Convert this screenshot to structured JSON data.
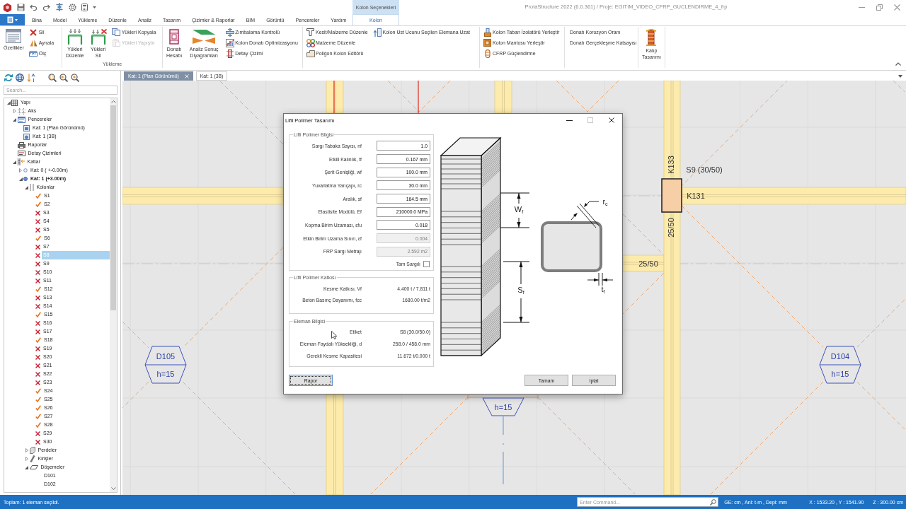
{
  "window": {
    "title": "ProtaStructure 2022 (6.0.361) / Proje: EGITIM_VIDEO_CFRP_GUCLENDIRME_4_frp"
  },
  "ribbon": {
    "context_header": "Kolon Seçenekleri",
    "tabs": [
      {
        "label": "Bina",
        "selected": false
      },
      {
        "label": "Model",
        "selected": false
      },
      {
        "label": "Yükleme",
        "selected": false
      },
      {
        "label": "Düzenle",
        "selected": false
      },
      {
        "label": "Analiz",
        "selected": false
      },
      {
        "label": "Tasarım",
        "selected": false
      },
      {
        "label": "Çizimler & Raporlar",
        "selected": false
      },
      {
        "label": "BIM",
        "selected": false
      },
      {
        "label": "Görüntü",
        "selected": false
      },
      {
        "label": "Pencereler",
        "selected": false
      },
      {
        "label": "Yardım",
        "selected": false
      },
      {
        "label": "Kolon",
        "selected": true
      }
    ],
    "groups": [
      {
        "items": [
          {
            "kind": "large",
            "label": "Özellikler",
            "disabled": false
          },
          {
            "kind": "small",
            "label": "Sil",
            "disabled": false
          },
          {
            "kind": "small",
            "label": "Aynala",
            "disabled": false
          },
          {
            "kind": "small",
            "label": "Ölç",
            "disabled": false
          }
        ]
      },
      {
        "label": "Yükleme",
        "items": [
          {
            "kind": "large",
            "label": "Yükleri Düzenle",
            "disabled": false
          },
          {
            "kind": "large",
            "label": "Yükleri Sil",
            "disabled": false
          },
          {
            "kind": "small",
            "label": "Yükleri Kopyala",
            "disabled": false
          },
          {
            "kind": "small",
            "label": "Yükleri Yapıştır",
            "disabled": true
          }
        ]
      },
      {
        "items": [
          {
            "kind": "large",
            "label": "Donatı Hesabı",
            "disabled": false
          },
          {
            "kind": "large",
            "label": "Analiz Sonuç Diyagramları",
            "disabled": false
          },
          {
            "kind": "small",
            "label": "Zımbalama Kontrolü",
            "disabled": false
          },
          {
            "kind": "small",
            "label": "Kolon Donatı Optimizasyonu",
            "disabled": false
          },
          {
            "kind": "small",
            "label": "Detay Çizimi",
            "disabled": false
          }
        ]
      },
      {
        "items": [
          {
            "kind": "small",
            "label": "Kesit/Malzeme Düzenle",
            "disabled": false
          },
          {
            "kind": "small",
            "label": "Malzeme Düzenle",
            "disabled": false
          },
          {
            "kind": "small",
            "label": "Poligon Kolon Editörü",
            "disabled": false
          },
          {
            "kind": "small",
            "label": "Kolon Üst Ucunu Seçilen Elemana Uzat",
            "disabled": false
          }
        ]
      },
      {
        "items": [
          {
            "kind": "small",
            "label": "Kolon Taban İzolatörü Yerleştir",
            "disabled": false
          },
          {
            "kind": "small",
            "label": "Kolon Mantosu Yerleştir",
            "disabled": false
          },
          {
            "kind": "small",
            "label": "CFRP Güçlendirme",
            "disabled": false
          }
        ]
      },
      {
        "items": [
          {
            "kind": "small",
            "label": "Donatı Korozyon Oranı",
            "disabled": false
          },
          {
            "kind": "small",
            "label": "Donatı Gerçekleşme Katsayısı",
            "disabled": false
          }
        ]
      },
      {
        "items": [
          {
            "kind": "large",
            "label": "Kalıp Tasarımı",
            "disabled": false
          }
        ]
      }
    ]
  },
  "explorer": {
    "search": {
      "placeholder": "Search..."
    },
    "tree": [
      {
        "label": "Yapı",
        "kind": "structure",
        "expanded": true,
        "selected": false,
        "children": [
          {
            "label": "Aks",
            "kind": "axes",
            "expanded": false,
            "selected": false
          },
          {
            "label": "Pencereler",
            "kind": "windows",
            "expanded": true,
            "selected": false,
            "children": [
              {
                "label": "Kat: 1 (Plan Görünümü)",
                "kind": "plan",
                "selected": false
              },
              {
                "label": "Kat: 1 (3B)",
                "kind": "perspective",
                "selected": false
              }
            ]
          },
          {
            "label": "Raporlar",
            "kind": "reports",
            "selected": false
          },
          {
            "label": "Detay Çizimleri",
            "kind": "drawings",
            "selected": false
          },
          {
            "label": "Katlar",
            "kind": "stories",
            "expanded": true,
            "selected": false,
            "children": [
              {
                "label": "Kat: 0 ( +-0.00m)",
                "kind": "story",
                "active": false,
                "expanded": false,
                "selected": false
              },
              {
                "label": "Kat: 1 (+3.00m)",
                "kind": "story",
                "active": true,
                "expanded": true,
                "selected": false,
                "children": [
                  {
                    "label": "Kolonlar",
                    "kind": "columns",
                    "expanded": true,
                    "selected": false,
                    "children": [
                      {
                        "label": "S1",
                        "kind": "column",
                        "passed": true,
                        "selected": false
                      },
                      {
                        "label": "S2",
                        "kind": "column",
                        "passed": true,
                        "selected": false
                      },
                      {
                        "label": "S3",
                        "kind": "column",
                        "passed": false,
                        "selected": false
                      },
                      {
                        "label": "S4",
                        "kind": "column",
                        "passed": false,
                        "selected": false
                      },
                      {
                        "label": "S5",
                        "kind": "column",
                        "passed": false,
                        "selected": false
                      },
                      {
                        "label": "S6",
                        "kind": "column",
                        "passed": true,
                        "selected": false
                      },
                      {
                        "label": "S7",
                        "kind": "column",
                        "passed": false,
                        "selected": false
                      },
                      {
                        "label": "S8",
                        "kind": "column",
                        "passed": false,
                        "selected": true
                      },
                      {
                        "label": "S9",
                        "kind": "column",
                        "passed": false,
                        "selected": false
                      },
                      {
                        "label": "S10",
                        "kind": "column",
                        "passed": false,
                        "selected": false
                      },
                      {
                        "label": "S11",
                        "kind": "column",
                        "passed": false,
                        "selected": false
                      },
                      {
                        "label": "S12",
                        "kind": "column",
                        "passed": true,
                        "selected": false
                      },
                      {
                        "label": "S13",
                        "kind": "column",
                        "passed": false,
                        "selected": false
                      },
                      {
                        "label": "S14",
                        "kind": "column",
                        "passed": false,
                        "selected": false
                      },
                      {
                        "label": "S15",
                        "kind": "column",
                        "passed": true,
                        "selected": false
                      },
                      {
                        "label": "S16",
                        "kind": "column",
                        "passed": false,
                        "selected": false
                      },
                      {
                        "label": "S17",
                        "kind": "column",
                        "passed": false,
                        "selected": false
                      },
                      {
                        "label": "S18",
                        "kind": "column",
                        "passed": true,
                        "selected": false
                      },
                      {
                        "label": "S19",
                        "kind": "column",
                        "passed": false,
                        "selected": false
                      },
                      {
                        "label": "S20",
                        "kind": "column",
                        "passed": false,
                        "selected": false
                      },
                      {
                        "label": "S21",
                        "kind": "column",
                        "passed": false,
                        "selected": false
                      },
                      {
                        "label": "S22",
                        "kind": "column",
                        "passed": false,
                        "selected": false
                      },
                      {
                        "label": "S23",
                        "kind": "column",
                        "passed": false,
                        "selected": false
                      },
                      {
                        "label": "S24",
                        "kind": "column",
                        "passed": true,
                        "selected": false
                      },
                      {
                        "label": "S25",
                        "kind": "column",
                        "passed": true,
                        "selected": false
                      },
                      {
                        "label": "S26",
                        "kind": "column",
                        "passed": true,
                        "selected": false
                      },
                      {
                        "label": "S27",
                        "kind": "column",
                        "passed": true,
                        "selected": false
                      },
                      {
                        "label": "S28",
                        "kind": "column",
                        "passed": true,
                        "selected": false
                      },
                      {
                        "label": "S29",
                        "kind": "column",
                        "passed": false,
                        "selected": false
                      },
                      {
                        "label": "S30",
                        "kind": "column",
                        "passed": false,
                        "selected": false
                      }
                    ]
                  },
                  {
                    "label": "Perdeler",
                    "kind": "walls",
                    "expanded": false,
                    "selected": false
                  },
                  {
                    "label": "Kirişler",
                    "kind": "beams",
                    "expanded": false,
                    "selected": false
                  },
                  {
                    "label": "Döşemeler",
                    "kind": "slabs",
                    "expanded": true,
                    "selected": false,
                    "children": [
                      {
                        "label": "D101",
                        "kind": "slab",
                        "selected": false
                      },
                      {
                        "label": "D102",
                        "kind": "slab",
                        "selected": false
                      }
                    ]
                  }
                ]
              }
            ]
          }
        ]
      }
    ]
  },
  "views": {
    "tabs": [
      {
        "label": "Kat: 1 (Plan Görünümü)",
        "selected": true
      },
      {
        "label": "Kat: 1 (3B)",
        "selected": false
      }
    ]
  },
  "plan": {
    "beam_labels": [
      {
        "text": "K133",
        "kind": "vertical"
      },
      {
        "text": "K131",
        "kind": "horizontal"
      },
      {
        "text": "25/50",
        "kind": "vertical"
      },
      {
        "text": "25/50",
        "kind": "horizontal"
      }
    ],
    "column_label": "S9 (30/50)",
    "slab_tags": [
      {
        "name": "D105",
        "thickness": "h=15"
      },
      {
        "name": "D104",
        "thickness": "h=15"
      },
      {
        "thickness": "h=15"
      }
    ]
  },
  "dialog": {
    "title": "Lifli Polimer Tasarımı",
    "frp_info": {
      "title": "Lifli Polimer Bilgisi",
      "fields": [
        {
          "label": "Sargı Tabaka Sayısı, nf",
          "value": "1.0",
          "disabled": false
        },
        {
          "label": "Etkili Kalınlık, tf",
          "value": "0.167 mm",
          "disabled": false
        },
        {
          "label": "Şerit Genişliği, wf",
          "value": "100.0 mm",
          "disabled": false
        },
        {
          "label": "Yuvarlatma Yarıçapı, rc",
          "value": "30.0 mm",
          "disabled": false
        },
        {
          "label": "Aralık, sf",
          "value": "164.5 mm",
          "disabled": false
        },
        {
          "label": "Elastisite Modülü, Ef",
          "value": "210000.0 MPa",
          "disabled": false
        },
        {
          "label": "Kopma Birim Uzaması, εfu",
          "value": "0.018",
          "disabled": false
        },
        {
          "label": "Etkin Birim Uzama Sınırı, εf",
          "value": "0.004",
          "disabled": true
        },
        {
          "label": "FRP Sargı Metrajı",
          "value": "2.592 m2",
          "disabled": true
        }
      ],
      "full_wrap": {
        "label": "Tam Sargılı",
        "checked": false
      }
    },
    "frp_contribution": {
      "title": "Lifli Polimer Katkısı",
      "rows": [
        {
          "label": "Kesme Katkısı, Vf",
          "value": "4.400 t / 7.811 t"
        },
        {
          "label": "Beton Basınç Dayanımı, fcc",
          "value": "1680.00 t/m2"
        }
      ]
    },
    "element_info": {
      "title": "Eleman Bilgisi",
      "rows": [
        {
          "label": "Etiket",
          "value": "S8 (30.0/50.0)"
        },
        {
          "label": "Eleman Faydalı Yüksekliği, d",
          "value": "258.0 / 458.0 mm"
        },
        {
          "label": "Gerekli Kesme Kapasitesi",
          "value": "11.672 t/0.000 t"
        }
      ]
    },
    "diagram": {
      "strip_width": "W$_{f}$",
      "spacing": "S$_{f}$",
      "radius": "r$_{c}$",
      "thickness": "t$_{f}$"
    },
    "buttons": [
      {
        "label": "Rapor",
        "focused": true
      },
      {
        "label": "Tamam",
        "focused": false
      },
      {
        "label": "İptal",
        "focused": false
      }
    ]
  },
  "status_bar": {
    "selection": "Toplam: 1 eleman seçildi.",
    "command": {
      "placeholder": "Enter Command..."
    },
    "units": "GE: cm , Anl: t-m , Depl: mm",
    "coordinates": "X : 1533.20 , Y : 1541.90",
    "elevation": "Z : 300.00 cm"
  }
}
